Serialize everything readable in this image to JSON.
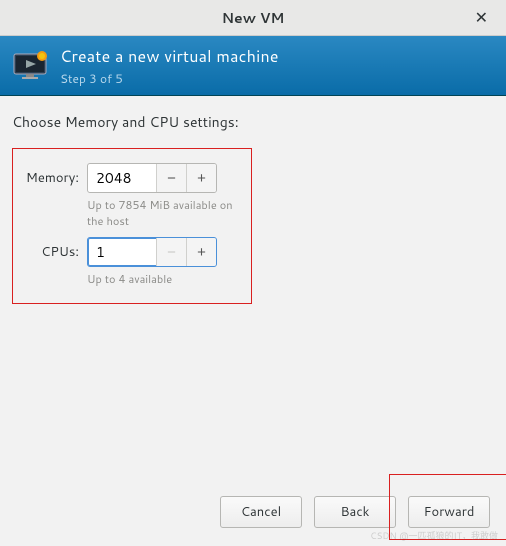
{
  "window": {
    "title": "New VM"
  },
  "banner": {
    "title": "Create a new virtual machine",
    "step": "Step 3 of 5"
  },
  "content": {
    "prompt": "Choose Memory and CPU settings:",
    "memory": {
      "label": "Memory:",
      "value": "2048",
      "hint": "Up to 7854 MiB available on the host"
    },
    "cpus": {
      "label": "CPUs:",
      "value": "1",
      "hint": "Up to 4 available"
    }
  },
  "buttons": {
    "cancel": "Cancel",
    "back": "Back",
    "forward": "Forward"
  },
  "glyphs": {
    "close": "✕",
    "minus": "−",
    "plus": "+"
  }
}
